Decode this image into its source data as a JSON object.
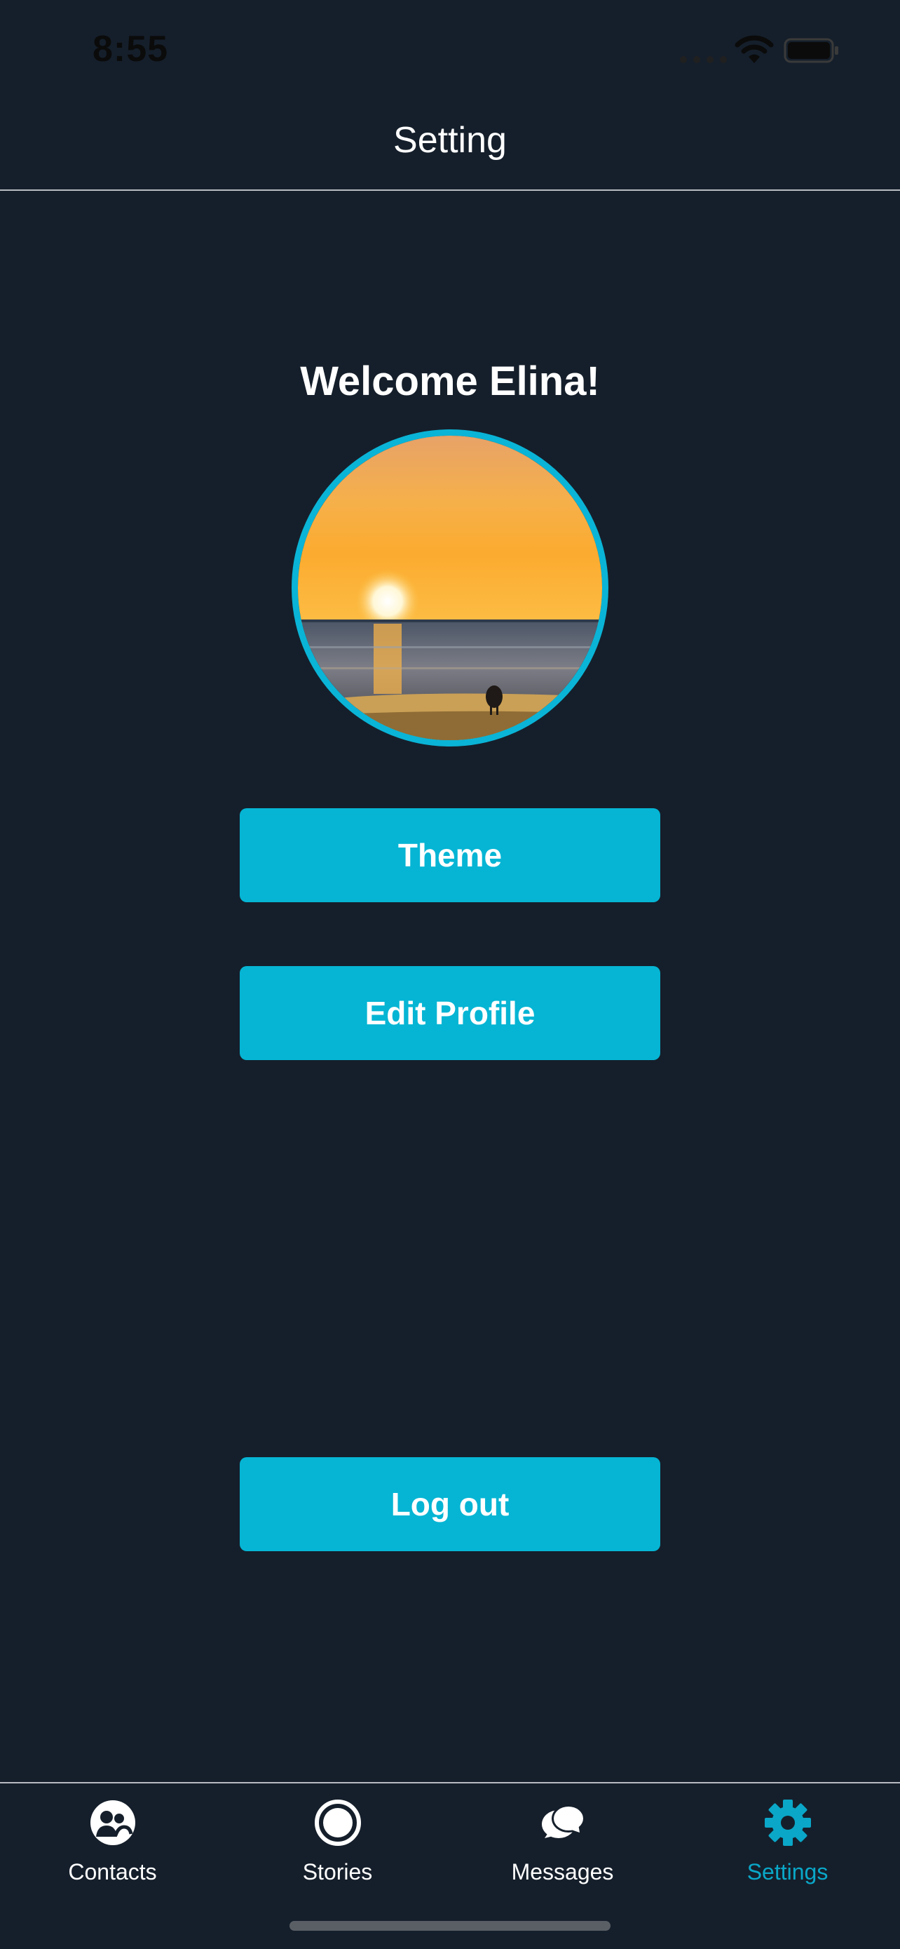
{
  "status_bar": {
    "time": "8:55"
  },
  "header": {
    "title": "Setting"
  },
  "profile": {
    "welcome": "Welcome Elina!"
  },
  "buttons": {
    "theme": "Theme",
    "edit_profile": "Edit Profile",
    "logout": "Log out"
  },
  "tabs": [
    {
      "label": "Contacts",
      "icon": "contacts-icon",
      "active": false
    },
    {
      "label": "Stories",
      "icon": "stories-icon",
      "active": false
    },
    {
      "label": "Messages",
      "icon": "messages-icon",
      "active": false
    },
    {
      "label": "Settings",
      "icon": "gear-icon",
      "active": true
    }
  ],
  "colors": {
    "background": "#151f2b",
    "accent": "#06b5d4",
    "active_tab": "#0aa7c8"
  }
}
